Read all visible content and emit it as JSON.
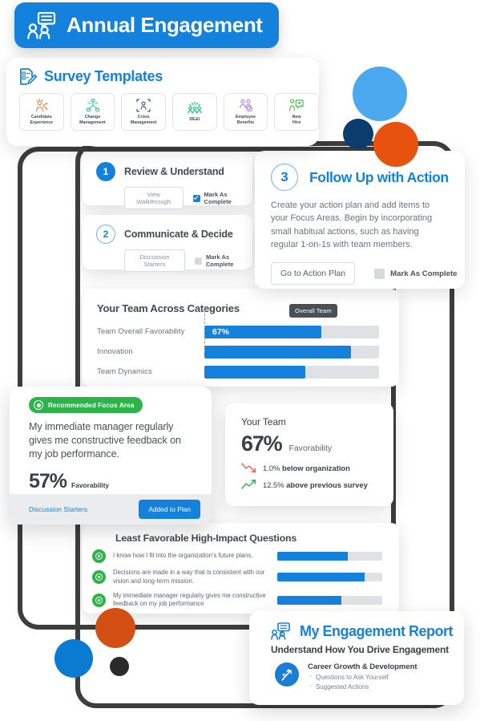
{
  "header": {
    "title": "Annual Engagement",
    "icon": "people-speech-bubble-icon",
    "accent": "#1482dd"
  },
  "survey_templates": {
    "title": "Survey Templates",
    "icon": "document-checklist-pencil-icon",
    "items": [
      {
        "label_line1": "Candidate",
        "label_line2": "Experience",
        "icon": "candidate-experience-icon",
        "color": "#f08a4b"
      },
      {
        "label_line1": "Change",
        "label_line2": "Management",
        "icon": "change-management-icon",
        "color": "#3fc9a0"
      },
      {
        "label_line1": "Crisis",
        "label_line2": "Management",
        "icon": "crisis-management-icon",
        "color": "#5b6470"
      },
      {
        "label_line1": "DE&I",
        "label_line2": "",
        "icon": "dei-icon",
        "color": "#1fbf7a"
      },
      {
        "label_line1": "Employee",
        "label_line2": "Benefits",
        "icon": "employee-benefits-icon",
        "color": "#b08ce0"
      },
      {
        "label_line1": "New",
        "label_line2": "Hire",
        "icon": "new-hire-icon",
        "color": "#49c24a"
      }
    ]
  },
  "steps": [
    {
      "number": "1",
      "title": "Review & Understand",
      "button": "View Walkthrough",
      "complete_label": "Mark As Complete",
      "complete_checked": true
    },
    {
      "number": "2",
      "title": "Communicate & Decide",
      "button": "Discussion Starters",
      "complete_label": "Mark As Complete",
      "complete_checked": false
    }
  ],
  "step3": {
    "number": "3",
    "title": "Follow Up with Action",
    "body": "Create your action plan and add items to your Focus Areas. Begin by incorporating small habitual actions, such as having regular 1-on-1s with team members.",
    "button": "Go to Action Plan",
    "complete_label": "Mark As Complete",
    "complete_checked": false
  },
  "chart_data": [
    {
      "type": "bar",
      "title": "Your Team Across Categories",
      "categories": [
        "Team Overall Favorability",
        "Innovation",
        "Team Dynamics"
      ],
      "values": [
        67,
        84,
        58
      ],
      "value_labels": [
        "67%",
        "",
        ""
      ],
      "annotation": "Overall Team",
      "marker_value": 67,
      "xlabel": "",
      "ylabel": "",
      "xlim": [
        0,
        100
      ],
      "grid": false,
      "bar_color": "#1482dd",
      "track_color": "#dfe1e5"
    },
    {
      "type": "bar",
      "title": "Least Favorable High-Impact Questions",
      "categories": [
        "I know how I fit into the organization's future plans.",
        "Decisions are made in a way that is consistent with our vision and long-term mission.",
        "My immediate manager regularly gives me constructive feedback on my job performance"
      ],
      "values": [
        67,
        83,
        61
      ],
      "xlim": [
        0,
        100
      ],
      "grid": false,
      "bar_color": "#1482dd",
      "track_color": "#dfe1e5"
    }
  ],
  "categories_card": {
    "title": "Your Team Across Categories",
    "tooltip": "Overall Team",
    "rows": [
      {
        "label": "Team Overall Favorability",
        "value": 67,
        "value_label": "67%"
      },
      {
        "label": "Innovation",
        "value": 84,
        "value_label": ""
      },
      {
        "label": "Team Dynamics",
        "value": 58,
        "value_label": ""
      }
    ]
  },
  "focus_area": {
    "badge": "Recommended Focus Area",
    "question": "My immediate manager regularly gives me constructive feedback on my job performance.",
    "score": "57%",
    "score_label": "Favorability",
    "bar_value": 57,
    "link": "Discussion Starters",
    "button": "Added to Plan"
  },
  "your_team": {
    "title": "Your Team",
    "score": "67%",
    "score_label": "Favorability",
    "stats": [
      {
        "icon": "trend-down-icon",
        "value": "1.0%",
        "text": "below organization",
        "color": "#e8625b"
      },
      {
        "icon": "trend-up-icon",
        "value": "12.5%",
        "text": "above previous survey",
        "color": "#3aa859"
      }
    ]
  },
  "least_favorable": {
    "title": "Least Favorable High-Impact Questions",
    "rows": [
      {
        "question": "I know how I fit into the organization's future plans.",
        "value": 67
      },
      {
        "question": "Decisions are made in a way that is consistent with our vision and long-term mission.",
        "value": 83
      },
      {
        "question": "My immediate manager regularly gives me constructive feedback on my job performance",
        "value": 61
      }
    ]
  },
  "report": {
    "title": "My Engagement Report",
    "subtitle": "Understand How You Drive Engagement",
    "section_title": "Career Growth & Development",
    "icon": "growth-plant-icon",
    "bullets": [
      "Questions to Ask Yourself",
      "Suggested Actions"
    ]
  }
}
